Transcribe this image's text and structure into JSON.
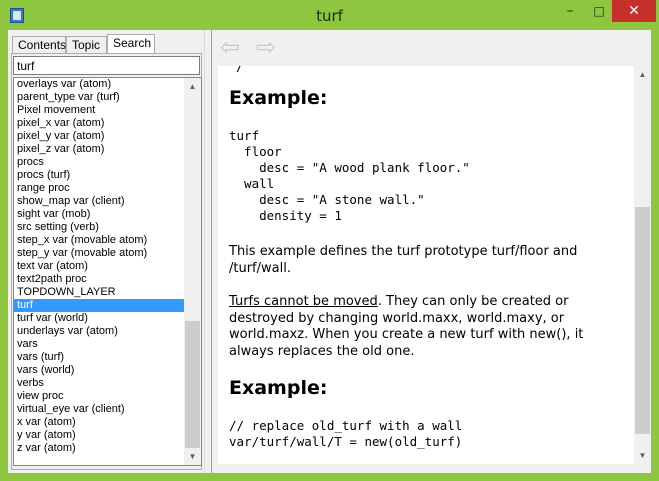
{
  "window": {
    "title": "turf",
    "icon": "help-book-icon",
    "buttons": {
      "minimize": "–",
      "maximize": "□",
      "close": "✕"
    }
  },
  "left_pane": {
    "tabs": [
      {
        "label": "Contents"
      },
      {
        "label": "Topic"
      },
      {
        "label": "Search"
      }
    ],
    "active_tab": "Search",
    "search_value": "turf",
    "results": [
      "overlays var (atom)",
      "parent_type var (turf)",
      "Pixel movement",
      "pixel_x var (atom)",
      "pixel_y var (atom)",
      "pixel_z var (atom)",
      "procs",
      "procs (turf)",
      "range proc",
      "show_map var (client)",
      "sight var (mob)",
      "src setting (verb)",
      "step_x var (movable atom)",
      "step_y var (movable atom)",
      "text var (atom)",
      "text2path proc",
      "TOPDOWN_LAYER",
      "turf",
      "turf var (world)",
      "underlays var (atom)",
      "vars",
      "vars (turf)",
      "vars (world)",
      "verbs",
      "view proc",
      "virtual_eye var (client)",
      "x var (atom)",
      "y var (atom)",
      "z var (atom)"
    ],
    "selected_index": 17
  },
  "right_pane": {
    "nav": {
      "back": "⇦",
      "forward": "⇨"
    },
    "top_fragment": "/",
    "example_heading_1": "Example:",
    "code_block_1": "turf\n  floor\n    desc = \"A wood plank floor.\"\n  wall\n    desc = \"A stone wall.\"\n    density = 1",
    "para_1": "This example defines the turf prototype turf/floor and /turf/wall.",
    "para_2_link": "Turfs cannot be moved",
    "para_2_rest": ". They can only be created or destroyed by changing world.maxx, world.maxy, or world.maxz. When you create a new turf with new(), it always replaces the old one.",
    "example_heading_2": "Example:",
    "code_block_2": "// replace old_turf with a wall\nvar/turf/wall/T = new(old_turf)"
  }
}
